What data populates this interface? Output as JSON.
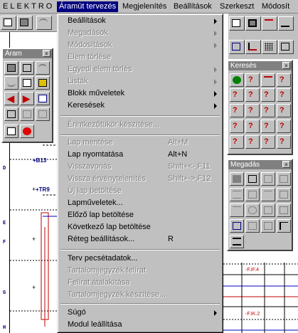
{
  "menubar": {
    "app_title": "ELEKTRO",
    "items": [
      "Áramút tervezés",
      "Megjelenítés",
      "Beállítások",
      "Szerkeszt",
      "Módosít"
    ]
  },
  "row_labels": [
    "D",
    "E",
    "F",
    "G",
    "H"
  ],
  "canvas_labels": {
    "b13": "+B13",
    "tr9": "+TR9"
  },
  "aram_palette": {
    "title": "Áram",
    "close": "×"
  },
  "kereses_palette": {
    "title": "Keresés",
    "close": "×"
  },
  "megadas_palette": {
    "title": "Megadás",
    "close": "×"
  },
  "menu": {
    "items": [
      {
        "label": "Beállítások",
        "enabled": true,
        "submenu": true
      },
      {
        "label": "Megadások",
        "enabled": false,
        "submenu": true
      },
      {
        "label": "Módosítások",
        "enabled": false,
        "submenu": true
      },
      {
        "label": "Elem törlése",
        "enabled": false
      },
      {
        "label": "Egyedi elem törlés",
        "enabled": false,
        "submenu": true
      },
      {
        "label": "Listák",
        "enabled": false,
        "submenu": true
      },
      {
        "label": "Blokk műveletek",
        "enabled": true,
        "submenu": true
      },
      {
        "label": "Keresések",
        "enabled": true,
        "submenu": true
      },
      {
        "label": "Érintkezőtükör készítése...",
        "enabled": false
      },
      {
        "label": "Lap mentése",
        "enabled": false,
        "shortcut": "Alt+M"
      },
      {
        "label": "Lap nyomtatása",
        "enabled": true,
        "shortcut": "Alt+N"
      },
      {
        "label": "Visszavonás",
        "enabled": false,
        "shortcut": "Shift+<-,F11"
      },
      {
        "label": "Vissza érvénytelenítés",
        "enabled": false,
        "shortcut": "Shift+->,F12"
      },
      {
        "label": "Új lap betöltése",
        "enabled": false
      },
      {
        "label": "Lapműveletek...",
        "enabled": true
      },
      {
        "label": "Előző lap betöltése",
        "enabled": true
      },
      {
        "label": "Következő lap betöltése",
        "enabled": true
      },
      {
        "label": "Réteg beállítások...",
        "enabled": true,
        "shortcut": "R"
      },
      {
        "label": "Terv pecsétadatok...",
        "enabled": true
      },
      {
        "label": "Tartalomjegyzék felírat",
        "enabled": false
      },
      {
        "label": "Felírat átalakítása",
        "enabled": false
      },
      {
        "label": "Tartalomjegyzék készítése...",
        "enabled": false
      },
      {
        "label": "Súgó",
        "enabled": true,
        "submenu": true
      },
      {
        "label": "Modul leállítása",
        "enabled": true
      }
    ]
  }
}
